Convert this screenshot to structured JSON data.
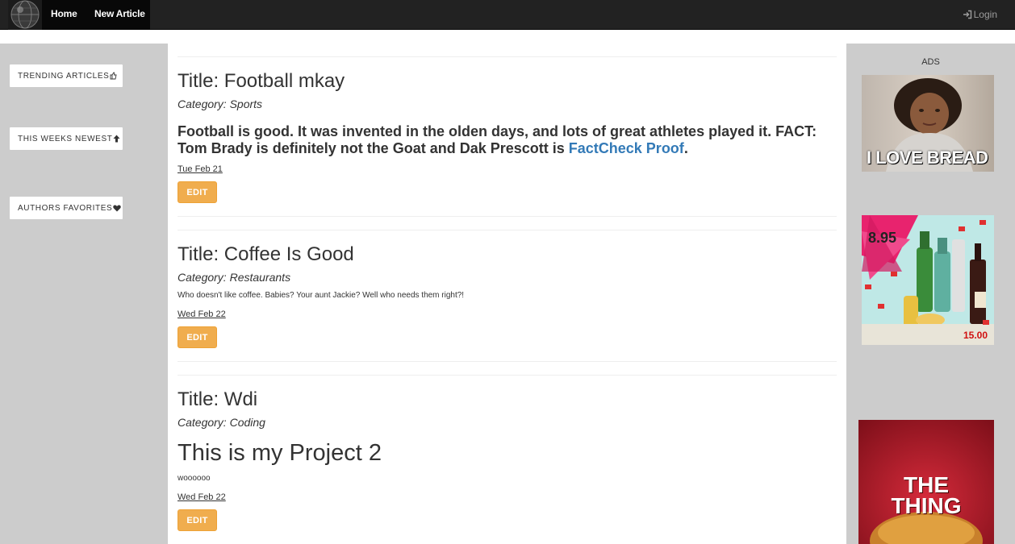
{
  "nav": {
    "home": "Home",
    "new_article": "New Article",
    "login": "Login"
  },
  "sidebar": {
    "items": [
      {
        "label": "TRENDING ARTICLES",
        "icon": "thumbs-up-icon"
      },
      {
        "label": "THIS WEEKS NEWEST",
        "icon": "arrow-up-icon"
      },
      {
        "label": "AUTHORS FAVORITES",
        "icon": "heart-icon"
      }
    ]
  },
  "articles": [
    {
      "title": "Title: Football mkay",
      "category": "Category: Sports",
      "body_text": "Football is good. It was invented in the olden days, and lots of great athletes played it. FACT: Tom Brady is definitely not the Goat and Dak Prescott is ",
      "body_link": "FactCheck Proof",
      "body_end": ".",
      "date": "Tue Feb 21",
      "edit": "EDIT"
    },
    {
      "title": "Title: Coffee Is Good",
      "category": "Category: Restaurants",
      "body_text": "Who doesn't like coffee. Babies? Your aunt Jackie? Well who needs them right?!",
      "date": "Wed Feb 22",
      "edit": "EDIT"
    },
    {
      "title": "Title: Wdi",
      "category": "Category: Coding",
      "heading": "This is my Project 2",
      "body_text": "woooooo",
      "date": "Wed Feb 22",
      "edit": "EDIT"
    }
  ],
  "ads": {
    "label": "ADS",
    "ad1_caption": "I LOVE BREAD",
    "ad2_price_a": "8.95",
    "ad2_price_b": "15.00",
    "ad3_caption": "THE THING"
  },
  "colors": {
    "navbar": "#222222",
    "sidebar": "#cccccc",
    "edit_button": "#f0ad4e",
    "link": "#337ab7"
  }
}
